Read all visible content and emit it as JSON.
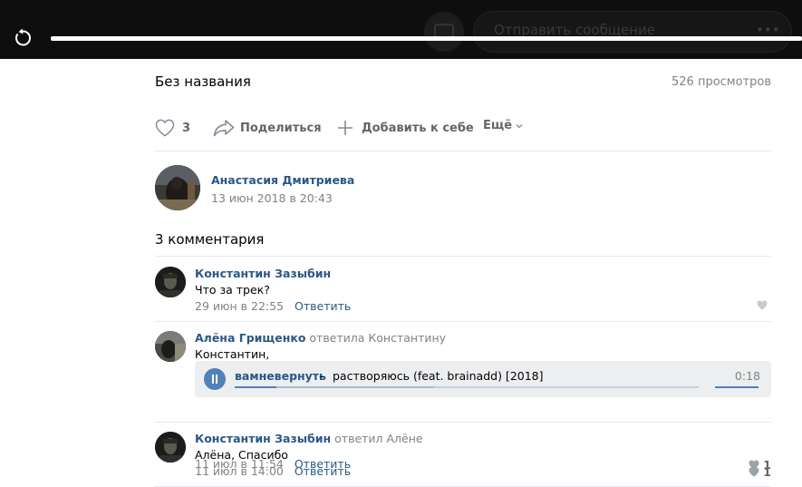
{
  "player": {
    "ghost_input_text": "Отправить сообщение",
    "ghost_dots": "•••"
  },
  "video": {
    "title": "Без названия",
    "views": "526 просмотров"
  },
  "actions": {
    "like_count": "3",
    "share_label": "Поделиться",
    "add_label": "Добавить к себе",
    "more_label": "Ещё"
  },
  "author": {
    "name": "Анастасия Дмитриева",
    "date": "13 июн 2018 в 20:43"
  },
  "comments": {
    "heading": "3 комментария",
    "items": [
      {
        "name": "Константин Зазыбин",
        "reply_to": "",
        "text": "Что за трек?",
        "date": "29 июн в 22:55",
        "reply_label": "Ответить",
        "likes": ""
      },
      {
        "name": "Алёна Грищенко",
        "reply_to": "ответила Константину",
        "text": "Константин,",
        "date": "11 июл в 11:54",
        "reply_label": "Ответить",
        "likes": "1",
        "audio": {
          "artist": "вамневернуть",
          "separator": "–",
          "title": "растворяюсь (feat. brainadd) [2018]",
          "duration": "0:18",
          "played_fraction": 0.09,
          "buffered_fraction": 0.43,
          "volume_fraction": 1.0
        }
      },
      {
        "name": "Константин Зазыбин",
        "reply_to": "ответил Алёне",
        "text": "Алёна, Спасибо",
        "date": "11 июл в 14:00",
        "reply_label": "Ответить",
        "likes": "1"
      }
    ]
  },
  "colors": {
    "link": "#2a5885",
    "accent": "#5181b8",
    "muted": "#828282"
  }
}
